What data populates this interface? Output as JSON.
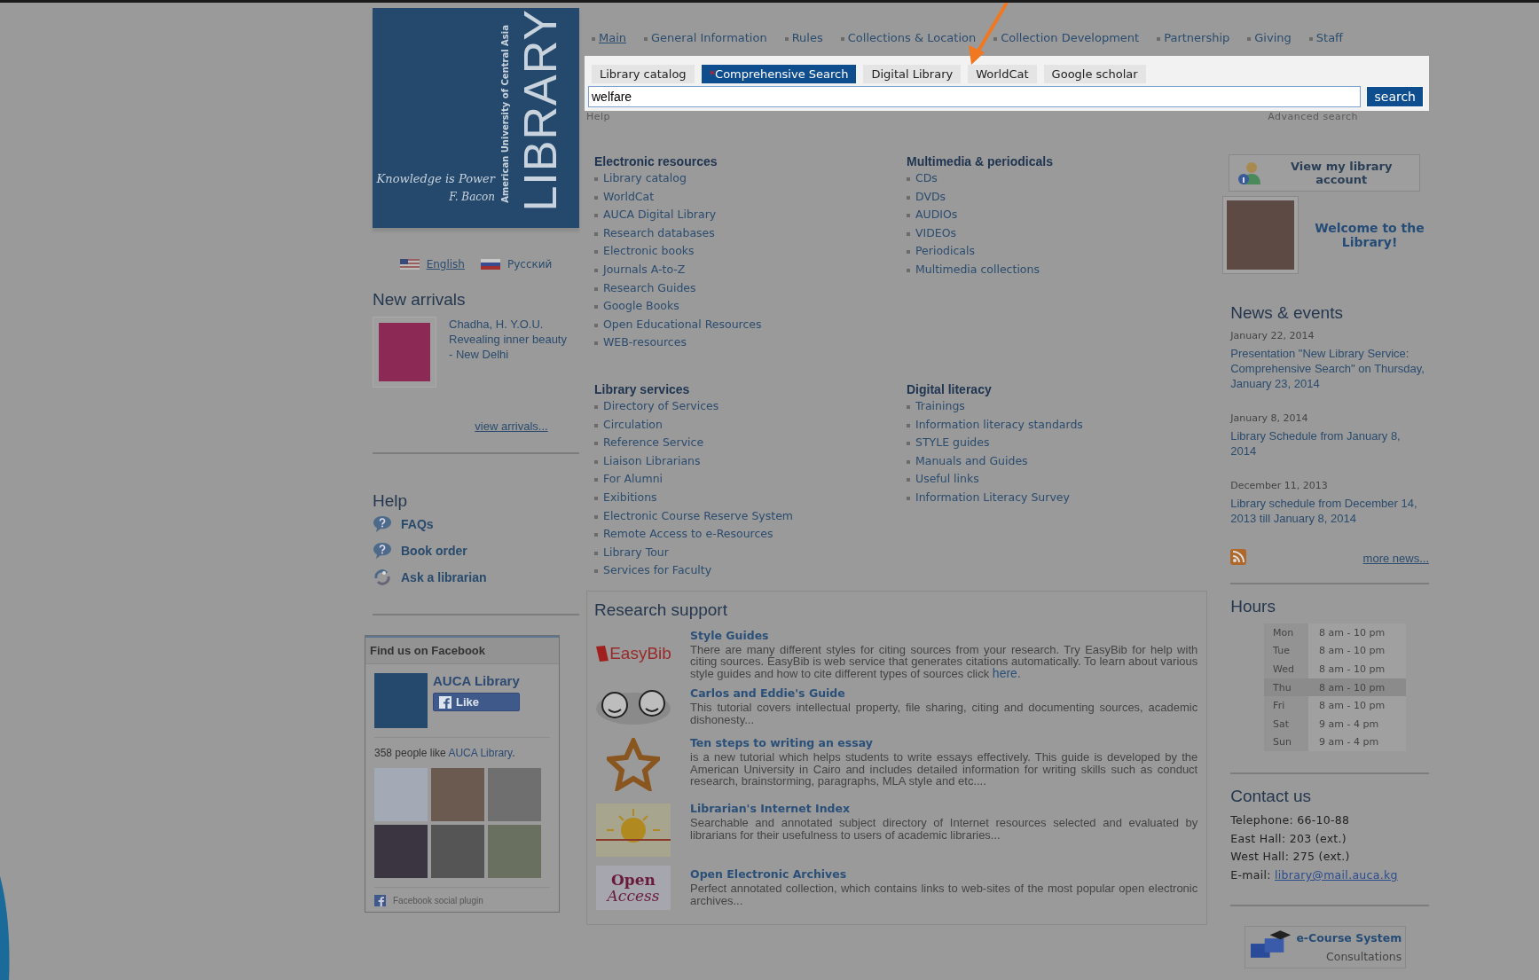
{
  "logo": {
    "tagline": "Knowledge is Power",
    "author": "F. Bacon",
    "university": "American University of Central Asia",
    "title": "LIBRARY"
  },
  "languages": [
    {
      "label": "English",
      "kind": "us",
      "selected": true
    },
    {
      "label": "Русский",
      "kind": "ru",
      "selected": false
    }
  ],
  "new_arrivals": {
    "title": "New arrivals",
    "items": [
      {
        "text": "Chadha, H. Y.O.U. Revealing inner beauty - New Delhi"
      }
    ],
    "more": "view arrivals..."
  },
  "help": {
    "title": "Help",
    "items": [
      {
        "label": "FAQs",
        "kind": "question"
      },
      {
        "label": "Book order",
        "kind": "question"
      },
      {
        "label": "Ask a librarian",
        "kind": "ask"
      }
    ]
  },
  "facebook": {
    "title": "Find us on Facebook",
    "page": "AUCA Library",
    "like": "Like",
    "count": "358 people like",
    "count_link": "AUCA Library",
    "count_end": ".",
    "footer": "Facebook social plugin"
  },
  "nav": [
    {
      "label": "Main",
      "selected": true
    },
    {
      "label": "General Information",
      "selected": false
    },
    {
      "label": "Rules",
      "selected": false
    },
    {
      "label": "Collections & Location",
      "selected": false
    },
    {
      "label": "Collection Development",
      "selected": false
    },
    {
      "label": "Partnership",
      "selected": false
    },
    {
      "label": "Giving",
      "selected": false
    },
    {
      "label": "Staff",
      "selected": false
    }
  ],
  "search": {
    "tabs": [
      {
        "label": "Library catalog",
        "selected": false
      },
      {
        "label": "Comprehensive Search",
        "mark": "*",
        "selected": true
      },
      {
        "label": "Digital Library",
        "selected": false
      },
      {
        "label": "WorldCat",
        "selected": false
      },
      {
        "label": "Google scholar",
        "selected": false
      }
    ],
    "value": "welfare",
    "button": "search",
    "help": "Help",
    "advanced": "Advanced search"
  },
  "sections": [
    {
      "title": "Electronic resources",
      "links": [
        "Library catalog",
        "WorldCat",
        "AUCA Digital Library",
        "Research databases",
        "Electronic books",
        "Journals A-to-Z",
        "Research Guides",
        "Google Books",
        "Open Educational Resources",
        "WEB-resources"
      ]
    },
    {
      "title": "Multimedia & periodicals",
      "links": [
        "CDs",
        "DVDs",
        "AUDIOs",
        "VIDEOs",
        "Periodicals",
        "Multimedia collections"
      ]
    },
    {
      "title": "Library services",
      "links": [
        "Directory of Services",
        "Circulation",
        "Reference Service",
        "Liaison Librarians",
        "For Alumni",
        "Exibitions",
        "Electronic Course Reserve System",
        "Remote Access to e-Resources",
        "Library Tour",
        "Services for Faculty"
      ]
    },
    {
      "title": "Digital literacy",
      "links": [
        "Trainings",
        "Information literacy standards",
        "STYLE guides",
        "Manuals and Guides",
        "Useful links",
        "Information Literacy Survey"
      ]
    }
  ],
  "research": {
    "title": "Research support",
    "items": [
      {
        "kind": "easybib",
        "logo_text": "EasyBib",
        "title": "Style Guides",
        "text": "There are many different styles for citing sources from your research. Try EasyBib for help with citing sources. EasyBib is web service that generates citations automatically. To learn about various style guides and how to cite different types of sources click",
        "link": "here",
        "after": "."
      },
      {
        "kind": "faces",
        "title": "Carlos and Eddie's Guide",
        "text": "This tutorial covers intellectual property, file sharing, citing and documenting sources, academic dishonesty..."
      },
      {
        "kind": "star",
        "title": "Ten steps to writing an essay",
        "text": "is a new tutorial which helps students to write essays effectively. This guide is developed by the American University in Cairo and includes detailed information for writing skills such as conduct research, brainstorming, paragraphs, MLA style and etc...."
      },
      {
        "kind": "sun",
        "title": "Librarian's Internet Index",
        "text": "Searchable and annotated subject directory of Internet resources selected and evaluated by librarians for their usefulness to users of academic libraries..."
      },
      {
        "kind": "open",
        "logo_text": "Open",
        "logo_text_2": "Access",
        "title": "Open Electronic Archives",
        "text": "Perfect annotated collection, which contains links to web-sites of the most popular open electronic archives..."
      }
    ]
  },
  "account": {
    "label": "View my library account"
  },
  "welcome": {
    "label": "Welcome to the Library!"
  },
  "news": {
    "title": "News & events",
    "items": [
      {
        "date": "January 22, 2014",
        "text": "Presentation \"New Library Service: Comprehensive Search\" on Thursday, January 23, 2014"
      },
      {
        "date": "January 8, 2014",
        "text": "Library Schedule from January 8, 2014"
      },
      {
        "date": "December 11, 2013",
        "text": "Library schedule from December 14, 2013 till January 8, 2014"
      }
    ],
    "more": "more news..."
  },
  "hours": {
    "title": "Hours",
    "rows": [
      {
        "day": "Mon",
        "time": "8 am - 10 pm",
        "selected": false
      },
      {
        "day": "Tue",
        "time": "8 am - 10 pm",
        "selected": false
      },
      {
        "day": "Wed",
        "time": "8 am - 10 pm",
        "selected": false
      },
      {
        "day": "Thu",
        "time": "8 am - 10 pm",
        "selected": true
      },
      {
        "day": "Fri",
        "time": "8 am - 10 pm",
        "selected": false
      },
      {
        "day": "Sat",
        "time": "9 am - 4 pm",
        "selected": false
      },
      {
        "day": "Sun",
        "time": "9 am - 4 pm",
        "selected": false
      }
    ]
  },
  "contact": {
    "title": "Contact us",
    "lines": [
      "Telephone: 66-10-88",
      "East Hall: 203 (ext.)",
      "West Hall: 275 (ext.)"
    ],
    "email_label": "E-mail:",
    "email": "library@mail.auca.kg"
  },
  "ecourse": {
    "title": "e-Course System",
    "subtitle": "Consultations"
  }
}
